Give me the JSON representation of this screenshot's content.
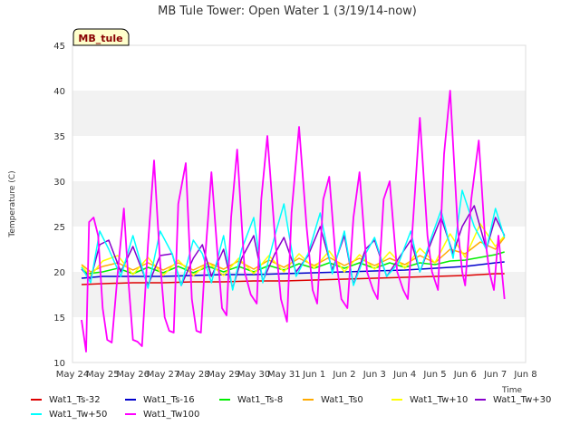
{
  "chart_data": {
    "type": "line",
    "title": "MB Tule Tower: Open Water 1 (3/19/14-now)",
    "xlabel": "Time",
    "ylabel": "Temperature (C)",
    "ylim": [
      10,
      45
    ],
    "yticks": [
      10,
      15,
      20,
      25,
      30,
      35,
      40,
      45
    ],
    "xlim": [
      0,
      15
    ],
    "xticks": [
      "May 24",
      "May 25",
      "May 26",
      "May 27",
      "May 28",
      "May 29",
      "May 30",
      "May 31",
      "Jun 1",
      "Jun 2",
      "Jun 3",
      "Jun 4",
      "Jun 5",
      "Jun 6",
      "Jun 7",
      "Jun 8"
    ],
    "site_tag": "MB_tule",
    "legend_position": "bottom",
    "grid": "horizontal bands",
    "series": [
      {
        "name": "Wat1_Ts-32",
        "color": "#dd0000",
        "x": [
          0.3,
          1,
          2,
          3,
          4,
          5,
          6,
          7,
          8,
          9,
          10,
          11,
          12,
          13,
          14,
          14.3
        ],
        "values": [
          18.6,
          18.7,
          18.8,
          18.8,
          18.9,
          18.9,
          19.0,
          19.0,
          19.1,
          19.2,
          19.3,
          19.4,
          19.5,
          19.6,
          19.8,
          19.8
        ]
      },
      {
        "name": "Wat1_Ts-16",
        "color": "#0000cc",
        "x": [
          0.3,
          1,
          2,
          3,
          4,
          5,
          6,
          7,
          8,
          9,
          10,
          11,
          12,
          13,
          14,
          14.3
        ],
        "values": [
          19.3,
          19.5,
          19.5,
          19.5,
          19.6,
          19.7,
          19.7,
          19.8,
          19.9,
          20.0,
          20.1,
          20.2,
          20.4,
          20.6,
          21.0,
          21.1
        ]
      },
      {
        "name": "Wat1_Ts-8",
        "color": "#00ee00",
        "x": [
          0.3,
          0.5,
          1,
          1.5,
          2,
          2.5,
          3,
          3.5,
          4,
          4.5,
          5,
          5.5,
          6,
          6.5,
          7,
          7.5,
          8,
          8.5,
          9,
          9.5,
          10,
          10.5,
          11,
          11.5,
          12,
          12.5,
          13,
          13.5,
          14,
          14.3
        ],
        "values": [
          20.3,
          19.8,
          20.0,
          20.4,
          19.8,
          20.5,
          19.9,
          20.6,
          19.9,
          20.6,
          20.0,
          20.6,
          20.0,
          20.7,
          20.2,
          20.9,
          20.4,
          21.0,
          20.4,
          21.0,
          20.4,
          21.0,
          20.5,
          21.0,
          20.8,
          21.2,
          21.3,
          21.6,
          21.9,
          22.2
        ]
      },
      {
        "name": "Wat1_Ts0",
        "color": "#ffaa00",
        "x": [
          0.3,
          0.6,
          1,
          1.5,
          2,
          2.5,
          3,
          3.5,
          4,
          4.5,
          5,
          5.5,
          6,
          6.5,
          7,
          7.5,
          8,
          8.5,
          9,
          9.5,
          10,
          10.5,
          11,
          11.5,
          12,
          12.5,
          13,
          13.5,
          14,
          14.3
        ],
        "values": [
          20.8,
          20.0,
          20.6,
          21.0,
          20.2,
          21.0,
          20.2,
          21.0,
          20.2,
          21.0,
          20.3,
          21.2,
          20.3,
          21.3,
          20.5,
          21.5,
          20.7,
          21.6,
          20.7,
          21.5,
          20.7,
          21.5,
          20.8,
          21.8,
          21.0,
          22.5,
          22.0,
          23.3,
          22.5,
          23.8
        ]
      },
      {
        "name": "Wat1_Tw+10",
        "color": "#ffff00",
        "x": [
          0.3,
          0.6,
          1,
          1.5,
          2,
          2.5,
          3,
          3.5,
          4,
          4.5,
          5,
          5.5,
          6,
          6.5,
          7,
          7.5,
          8,
          8.5,
          9,
          9.5,
          10,
          10.5,
          11,
          11.5,
          12,
          12.5,
          13,
          13.5,
          14,
          14.3
        ],
        "values": [
          20.6,
          19.6,
          21.2,
          21.8,
          19.7,
          21.6,
          19.6,
          21.3,
          19.6,
          21.0,
          19.6,
          21.5,
          19.8,
          21.8,
          20.0,
          22.0,
          20.4,
          22.3,
          20.0,
          21.9,
          20.3,
          22.2,
          20.4,
          22.6,
          21.0,
          24.2,
          21.6,
          25.3,
          22.8,
          24.0
        ]
      },
      {
        "name": "Wat1_Tw+30",
        "color": "#8800cc",
        "x": [
          0.3,
          0.6,
          0.9,
          1.2,
          1.6,
          2.0,
          2.5,
          2.9,
          3.3,
          3.6,
          4.0,
          4.3,
          4.6,
          5.0,
          5.3,
          5.6,
          6.0,
          6.3,
          6.7,
          7.0,
          7.4,
          7.8,
          8.2,
          8.6,
          9.0,
          9.3,
          9.7,
          10.0,
          10.4,
          10.8,
          11.2,
          11.5,
          11.9,
          12.2,
          12.6,
          12.9,
          13.3,
          13.7,
          14.0,
          14.3
        ],
        "values": [
          20.3,
          19.2,
          23.0,
          23.5,
          20.0,
          22.8,
          18.5,
          21.8,
          22.0,
          18.5,
          21.5,
          23.0,
          19.5,
          22.5,
          18.2,
          21.5,
          24.0,
          19.0,
          22.0,
          23.8,
          20.0,
          21.8,
          25.0,
          20.2,
          24.0,
          18.6,
          22.5,
          23.5,
          19.5,
          21.5,
          23.5,
          20.0,
          23.5,
          26.0,
          22.0,
          25.0,
          27.3,
          22.5,
          26.0,
          24.0
        ]
      },
      {
        "name": "Wat1_Tw+50",
        "color": "#00ffff",
        "x": [
          0.3,
          0.6,
          0.9,
          1.2,
          1.6,
          2.0,
          2.5,
          2.9,
          3.3,
          3.6,
          4.0,
          4.3,
          4.6,
          5.0,
          5.3,
          5.6,
          6.0,
          6.3,
          6.7,
          7.0,
          7.4,
          7.8,
          8.2,
          8.6,
          9.0,
          9.3,
          9.7,
          10.0,
          10.4,
          10.8,
          11.2,
          11.5,
          11.9,
          12.2,
          12.6,
          12.9,
          13.3,
          13.7,
          14.0,
          14.3
        ],
        "values": [
          20.5,
          18.8,
          24.5,
          22.5,
          19.5,
          24.0,
          18.2,
          24.5,
          22.0,
          18.5,
          23.5,
          22.0,
          18.8,
          24.0,
          18.0,
          22.5,
          26.0,
          18.8,
          24.0,
          27.5,
          19.5,
          22.0,
          26.5,
          19.8,
          24.5,
          18.5,
          22.0,
          23.8,
          19.5,
          21.0,
          24.5,
          20.0,
          24.0,
          26.8,
          21.5,
          29.0,
          25.0,
          22.5,
          27.0,
          23.8
        ]
      },
      {
        "name": "Wat1_Tw100",
        "color": "#ff00ff",
        "x": [
          0.3,
          0.45,
          0.55,
          0.7,
          0.85,
          1.0,
          1.15,
          1.3,
          1.5,
          1.7,
          1.85,
          2.0,
          2.15,
          2.3,
          2.5,
          2.7,
          2.9,
          3.05,
          3.2,
          3.35,
          3.5,
          3.75,
          3.95,
          4.1,
          4.25,
          4.4,
          4.6,
          4.8,
          4.95,
          5.1,
          5.25,
          5.45,
          5.7,
          5.9,
          6.1,
          6.25,
          6.45,
          6.7,
          6.9,
          7.1,
          7.25,
          7.5,
          7.75,
          7.95,
          8.1,
          8.3,
          8.5,
          8.7,
          8.9,
          9.1,
          9.3,
          9.5,
          9.75,
          9.95,
          10.1,
          10.3,
          10.5,
          10.75,
          10.95,
          11.1,
          11.3,
          11.5,
          11.75,
          11.9,
          12.1,
          12.3,
          12.5,
          12.75,
          12.9,
          13.0,
          13.2,
          13.45,
          13.65,
          13.8,
          13.95,
          14.1,
          14.3
        ],
        "values": [
          14.7,
          11.2,
          25.5,
          26.0,
          24.0,
          16.0,
          12.5,
          12.2,
          20.0,
          27.0,
          19.0,
          12.5,
          12.3,
          11.8,
          23.0,
          32.3,
          21.0,
          15.0,
          13.5,
          13.3,
          27.5,
          32.0,
          17.0,
          13.5,
          13.3,
          22.0,
          31.0,
          22.0,
          16.0,
          15.2,
          26.0,
          33.5,
          20.0,
          17.5,
          16.5,
          28.0,
          35.0,
          24.0,
          17.0,
          14.5,
          26.5,
          36.0,
          25.0,
          18.0,
          16.5,
          28.0,
          30.5,
          22.0,
          17.0,
          16.0,
          26.0,
          31.0,
          20.0,
          18.0,
          17.0,
          28.0,
          30.0,
          20.0,
          18.0,
          17.0,
          27.0,
          37.0,
          24.0,
          20.0,
          18.0,
          33.0,
          40.0,
          25.0,
          20.0,
          18.5,
          28.0,
          34.5,
          24.0,
          20.0,
          18.0,
          24.0,
          17.0
        ]
      }
    ]
  }
}
